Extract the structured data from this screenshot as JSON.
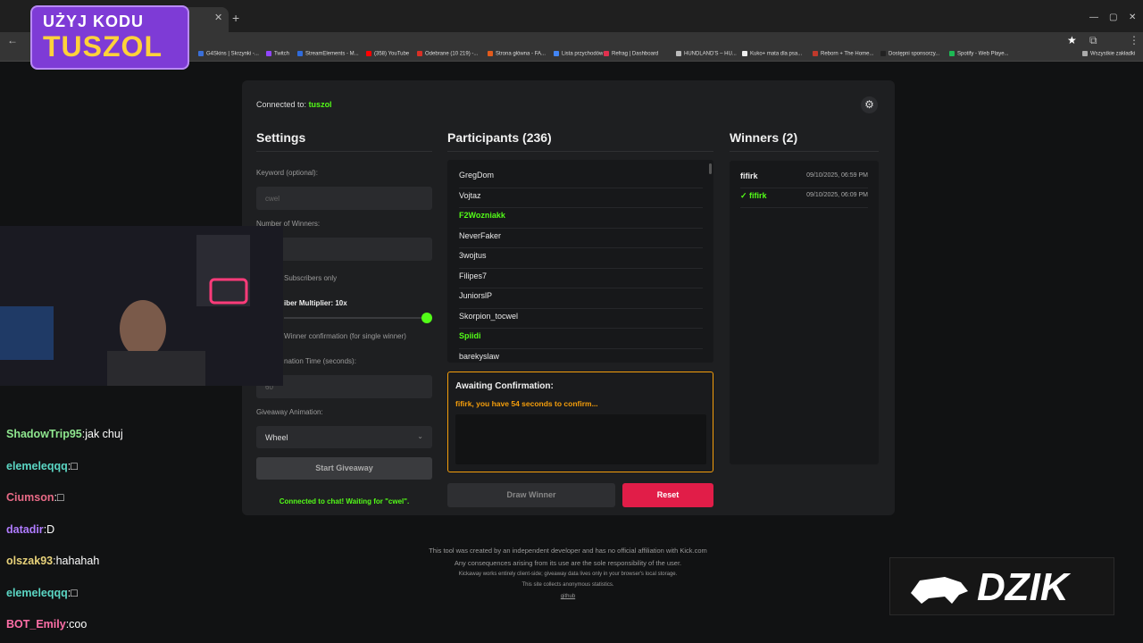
{
  "browser": {
    "bookmarks": [
      {
        "label": "G4Skins | Skrzynki -...",
        "color": "#3a6fd8"
      },
      {
        "label": "Twitch",
        "color": "#9146ff"
      },
      {
        "label": "StreamElements - M...",
        "color": "#2f6bdb"
      },
      {
        "label": "(358) YouTube",
        "color": "#ff0000"
      },
      {
        "label": "Odebrane (10 219) -...",
        "color": "#d93025"
      },
      {
        "label": "Strona główna - FA...",
        "color": "#e25b1c"
      },
      {
        "label": "Lista przychodów",
        "color": "#4285f4"
      },
      {
        "label": "Refrag | Dashboard",
        "color": "#e0304e"
      },
      {
        "label": "HUNDLAND'S – HU...",
        "color": "#bbbbbb"
      },
      {
        "label": "Kuko+ mata dla psa...",
        "color": "#eeeeee"
      },
      {
        "label": "Reborn + The Home...",
        "color": "#c0392b"
      },
      {
        "label": "Dostępni sponsorzy...",
        "color": "#222222"
      },
      {
        "label": "Spotify - Web Playe...",
        "color": "#1db954"
      }
    ],
    "all_bookmarks": "Wszystkie zakładki"
  },
  "header": {
    "connected_prefix": "Connected to:",
    "channel": "tuszol"
  },
  "settings": {
    "title": "Settings",
    "keyword_label": "Keyword (optional):",
    "keyword_placeholder": "cwel",
    "winners_label": "Number of Winners:",
    "subscribers_label": "Subscribers only",
    "multiplier_label": "iber Multiplier: 10x",
    "multiplier_value": 10,
    "confirmation_label": "Winner confirmation (for single winner)",
    "time_label": "nation Time (seconds):",
    "time_value": "60",
    "animation_label": "Giveaway Animation:",
    "animation_value": "Wheel",
    "start_button": "Start Giveaway",
    "status": "Connected to chat! Waiting for \"cwel\"."
  },
  "participants": {
    "title": "Participants (236)",
    "list": [
      {
        "name": "GregDom",
        "sub": false
      },
      {
        "name": "Vojtaz",
        "sub": false
      },
      {
        "name": "F2Wozniakk",
        "sub": true
      },
      {
        "name": "NeverFaker",
        "sub": false
      },
      {
        "name": "3wojtus",
        "sub": false
      },
      {
        "name": "Filipes7",
        "sub": false
      },
      {
        "name": "JuniorslP",
        "sub": false
      },
      {
        "name": "Skorpion_tocwel",
        "sub": false
      },
      {
        "name": "Spiidi",
        "sub": true
      },
      {
        "name": "barekyslaw",
        "sub": false
      }
    ]
  },
  "awaiting": {
    "title": "Awaiting Confirmation:",
    "message": "fifirk, you have 54 seconds to confirm..."
  },
  "actions": {
    "draw": "Draw Winner",
    "reset": "Reset"
  },
  "winners": {
    "title": "Winners (2)",
    "list": [
      {
        "name": "fifirk",
        "time": "09/10/2025, 06:59 PM",
        "confirmed": false
      },
      {
        "name": "✓ fifirk",
        "time": "09/10/2025, 06:09 PM",
        "confirmed": true
      }
    ]
  },
  "footer": {
    "line1": "This tool was created by an independent developer and has no official affiliation with Kick.com",
    "line2": "Any consequences arising from its use are the sole responsibility of the user.",
    "line3": "Kickaway works entirely client-side; giveaway data lives only in your browser's local storage.",
    "line4": "This site collects anonymous statistics.",
    "link": "github"
  },
  "overlay": {
    "promo_line1": "UŻYJ KODU",
    "promo_line2": "TUSZOL",
    "brand": "DZIK",
    "chat": [
      {
        "user": "ShadowTrip95",
        "sep": ":",
        "msg": "jak chuj",
        "color": "#8fe78f"
      },
      {
        "user": "elemeleqqq",
        "sep": ":",
        "msg": "□",
        "color": "#5bd6c4"
      },
      {
        "user": "Ciumson",
        "sep": ":",
        "msg": "□",
        "color": "#e86a86"
      },
      {
        "user": "datadir",
        "sep": ":",
        "msg": "D",
        "color": "#b07cff"
      },
      {
        "user": "olszak93",
        "sep": ":",
        "msg": "hahahah",
        "color": "#e8d27a"
      },
      {
        "user": "elemeleqqq",
        "sep": ":",
        "msg": "□",
        "color": "#5bd6c4"
      },
      {
        "user": "BOT_Emily",
        "sep": ":",
        "msg": "coo",
        "color": "#ff6fa8"
      }
    ]
  }
}
